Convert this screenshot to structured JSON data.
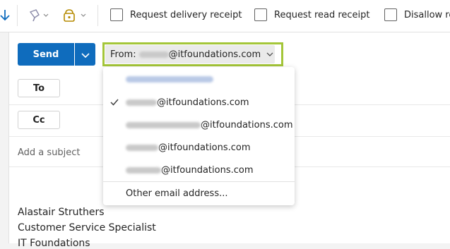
{
  "icons": {
    "send_arrow": "down-arrow-icon",
    "format_painter": "format-painter-icon",
    "sensitivity": "lock-bag-icon",
    "dropdown": "chevron-down-icon",
    "checkmark": "checkmark-icon"
  },
  "colors": {
    "accent": "#0f6cbd",
    "highlight": "#a4c639"
  },
  "toolbar": {
    "options": [
      {
        "label": "Request delivery receipt",
        "checked": false
      },
      {
        "label": "Request read receipt",
        "checked": false
      },
      {
        "label": "Disallow re",
        "checked": false
      }
    ]
  },
  "compose": {
    "send_label": "Send",
    "from_prefix": "From:",
    "from_domain": "@itfoundations.com",
    "to_label": "To",
    "cc_label": "Cc",
    "subject_placeholder": "Add a subject",
    "signature": [
      "Alastair Struthers",
      "Customer Service Specialist",
      "IT Foundations"
    ]
  },
  "from_menu": {
    "items": [
      {
        "domain": "@itfoundations.com",
        "selected": true
      },
      {
        "domain": "@itfoundations.com",
        "selected": false
      },
      {
        "domain": "@itfoundations.com",
        "selected": false
      },
      {
        "domain": "@itfoundations.com",
        "selected": false
      }
    ],
    "other_label": "Other email address..."
  }
}
